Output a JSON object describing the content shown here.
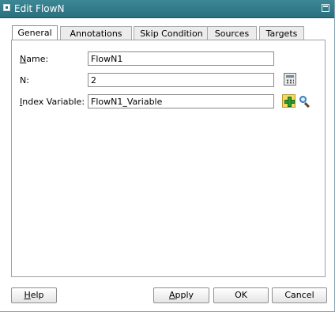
{
  "window": {
    "title": "Edit FlowN"
  },
  "tabs": [
    {
      "label": "General",
      "active": true
    },
    {
      "label": "Annotations",
      "active": false
    },
    {
      "label": "Skip Condition",
      "active": false
    },
    {
      "label": "Sources",
      "active": false
    },
    {
      "label": "Targets",
      "active": false
    }
  ],
  "form": {
    "name": {
      "label_underlined": "N",
      "label_rest": "ame:",
      "value": "FlowN1"
    },
    "n": {
      "label": "N:",
      "value": "2"
    },
    "index_variable": {
      "label_underlined": "I",
      "label_rest": "ndex Variable:",
      "value": "FlowN1_Variable"
    }
  },
  "buttons": {
    "help": {
      "label_underlined": "H",
      "label_rest": "elp"
    },
    "apply": {
      "label_underlined": "A",
      "label_rest": "pply"
    },
    "ok": {
      "label": "OK"
    },
    "cancel": {
      "label": "Cancel"
    }
  },
  "icons": {
    "expression_builder": "calculator-icon",
    "create_variable": "add-icon",
    "browse_variable": "search-icon",
    "window": "window-icon",
    "maximize": "maximize-icon"
  }
}
